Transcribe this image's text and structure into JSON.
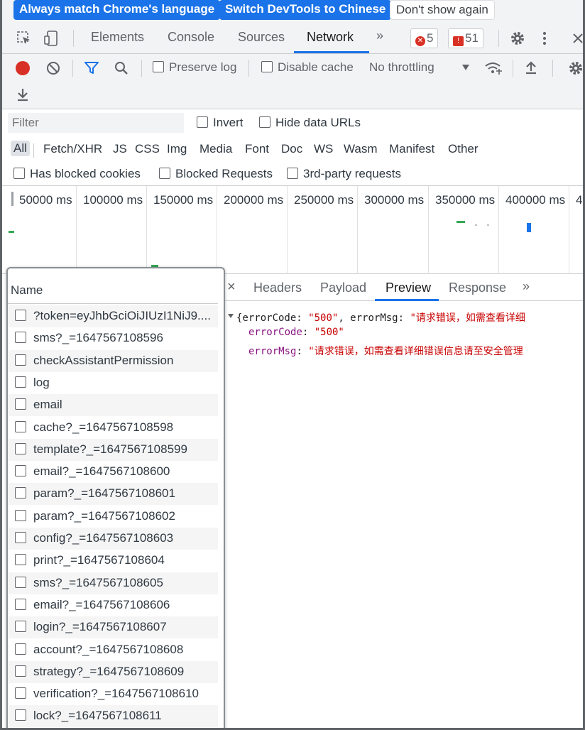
{
  "lang_bar": {
    "match_label": "Always match Chrome's language",
    "switch_label": "Switch DevTools to Chinese",
    "dont_show_label": "Don't show again"
  },
  "tabs": {
    "items": [
      "Elements",
      "Console",
      "Sources",
      "Network"
    ],
    "active": "Network",
    "more": "»",
    "error_count": "5",
    "issue_count": "51"
  },
  "toolbar": {
    "preserve_log": "Preserve log",
    "disable_cache": "Disable cache",
    "throttling": "No throttling"
  },
  "filter": {
    "placeholder": "Filter",
    "invert": "Invert",
    "hide_data_urls": "Hide data URLs"
  },
  "types": [
    "All",
    "Fetch/XHR",
    "JS",
    "CSS",
    "Img",
    "Media",
    "Font",
    "Doc",
    "WS",
    "Wasm",
    "Manifest",
    "Other"
  ],
  "blocked": {
    "has_blocked_cookies": "Has blocked cookies",
    "blocked_requests": "Blocked Requests",
    "third_party": "3rd-party requests"
  },
  "timeline": {
    "ticks": [
      "50000 ms",
      "100000 ms",
      "150000 ms",
      "200000 ms",
      "250000 ms",
      "300000 ms",
      "350000 ms",
      "400000 ms",
      "4"
    ]
  },
  "name_panel": {
    "header": "Name",
    "rows": [
      "?token=eyJhbGciOiJIUzI1NiJ9....",
      "sms?_=1647567108596",
      "checkAssistantPermission",
      "log",
      "email",
      "cache?_=1647567108598",
      "template?_=1647567108599",
      "email?_=1647567108600",
      "param?_=1647567108601",
      "param?_=1647567108602",
      "config?_=1647567108603",
      "print?_=1647567108604",
      "sms?_=1647567108605",
      "email?_=1647567108606",
      "login?_=1647567108607",
      "account?_=1647567108608",
      "strategy?_=1647567108609",
      "verification?_=1647567108610",
      "lock?_=1647567108611"
    ]
  },
  "detail": {
    "close": "×",
    "tabs": [
      "Headers",
      "Payload",
      "Preview",
      "Response"
    ],
    "active": "Preview",
    "more": "»"
  },
  "preview": {
    "summary_open": "{errorCode: ",
    "summary_code_value": "\"500\"",
    "summary_mid": ", errorMsg: ",
    "summary_msg_value": "\"请求错误，如需查看详细",
    "error_code_key": "errorCode",
    "error_code_value": "\"500\"",
    "error_msg_key": "errorMsg",
    "error_msg_value": "\"请求错误，如需查看详细错误信息请至安全管理"
  },
  "colors": {
    "accent": "#1a73e8",
    "error": "#d93025",
    "toolbar_bg": "#f1f3f4",
    "json_key": "#881280",
    "json_string": "#c80000"
  }
}
